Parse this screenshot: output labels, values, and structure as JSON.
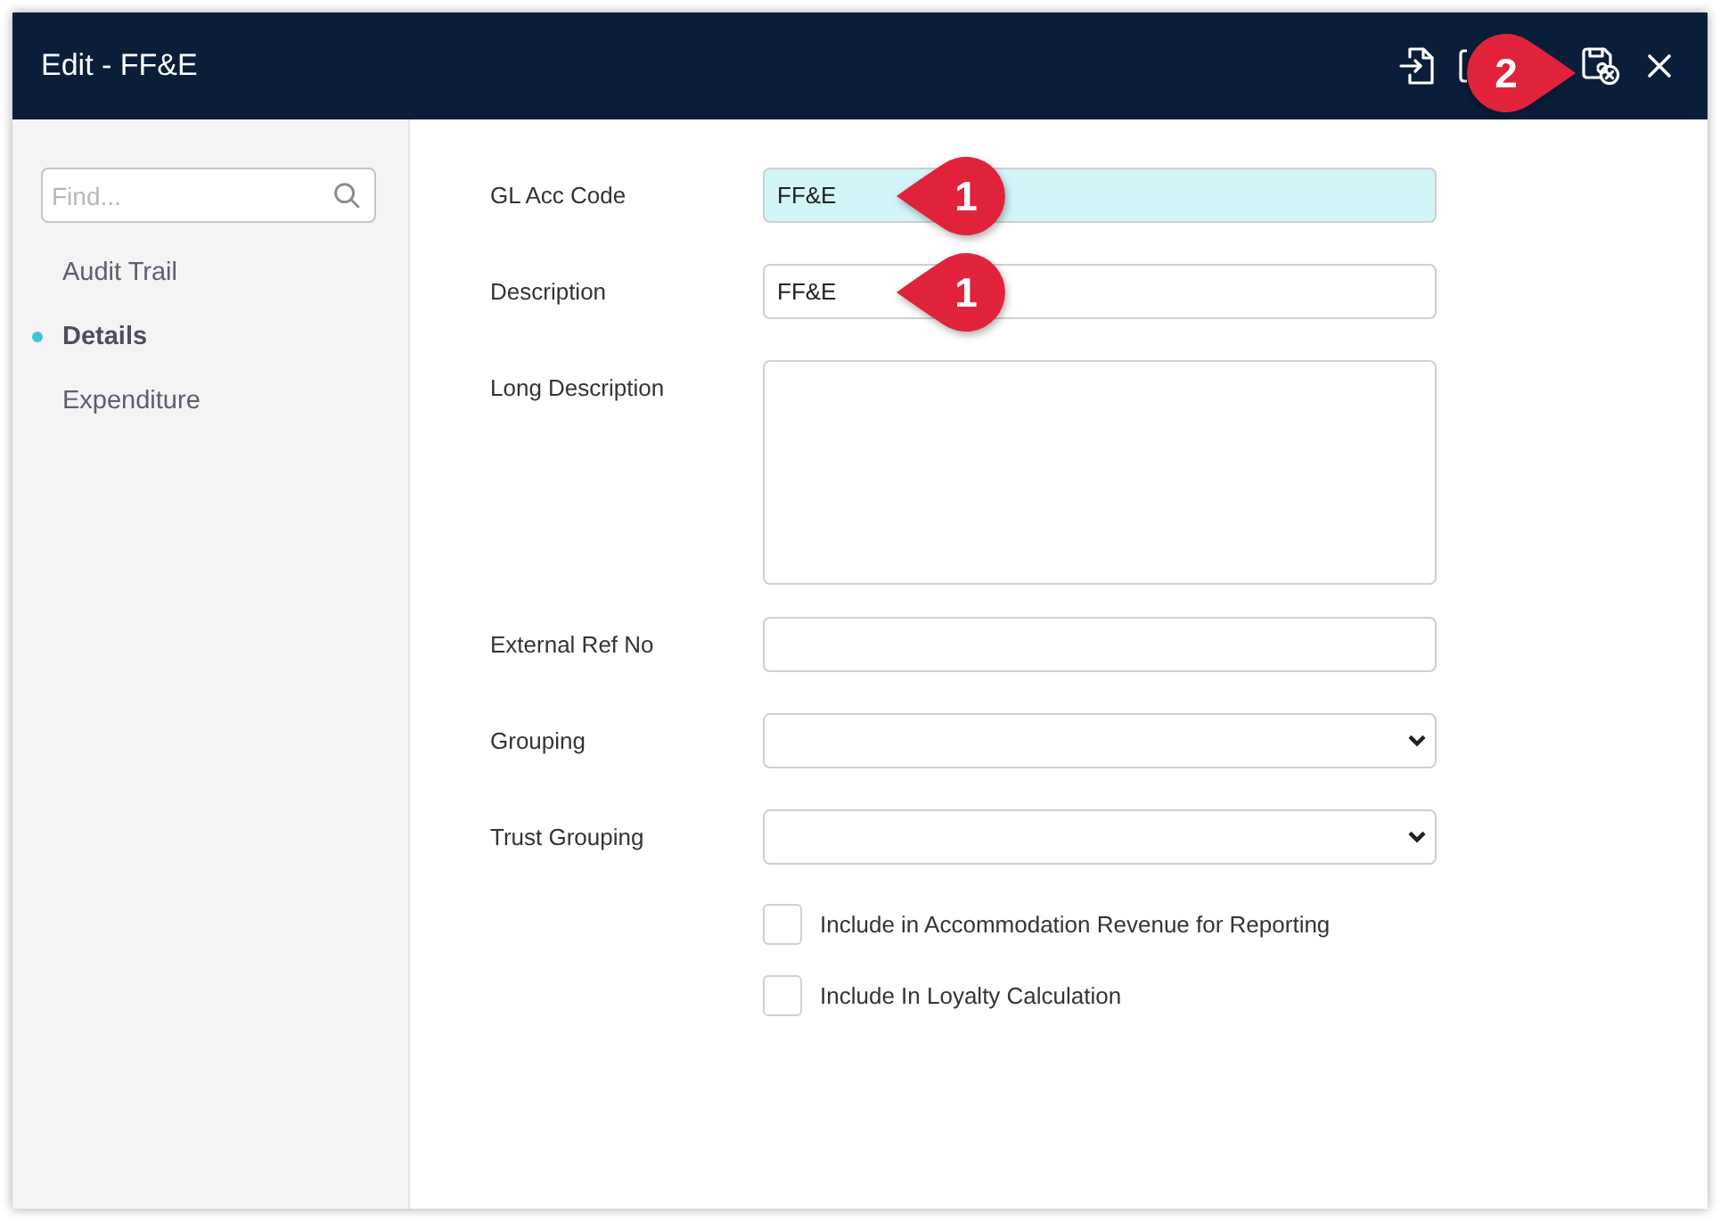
{
  "window": {
    "title": "Edit - FF&E",
    "callout": "2"
  },
  "sidebar": {
    "search": {
      "placeholder": "Find..."
    },
    "items": [
      {
        "label": "Audit Trail",
        "selected": false
      },
      {
        "label": "Details",
        "selected": true
      },
      {
        "label": "Expenditure",
        "selected": false
      }
    ]
  },
  "form": {
    "fields": [
      {
        "kind": "text",
        "label": "GL Acc Code",
        "value": "FF&E",
        "highlighted": true,
        "callout": "1"
      },
      {
        "kind": "text",
        "label": "Description",
        "value": "FF&E",
        "highlighted": false,
        "callout": "1"
      },
      {
        "kind": "textarea",
        "label": "Long Description",
        "highlighted": false
      },
      {
        "kind": "text",
        "label": "External Ref No",
        "highlighted": false
      },
      {
        "kind": "select",
        "label": "Grouping",
        "highlighted": false
      },
      {
        "kind": "select",
        "label": "Trust Grouping",
        "highlighted": false
      }
    ],
    "checkboxes": [
      {
        "label": "Include in Accommodation Revenue for Reporting",
        "checked": false
      },
      {
        "label": "Include In Loyalty Calculation",
        "checked": false
      }
    ]
  }
}
